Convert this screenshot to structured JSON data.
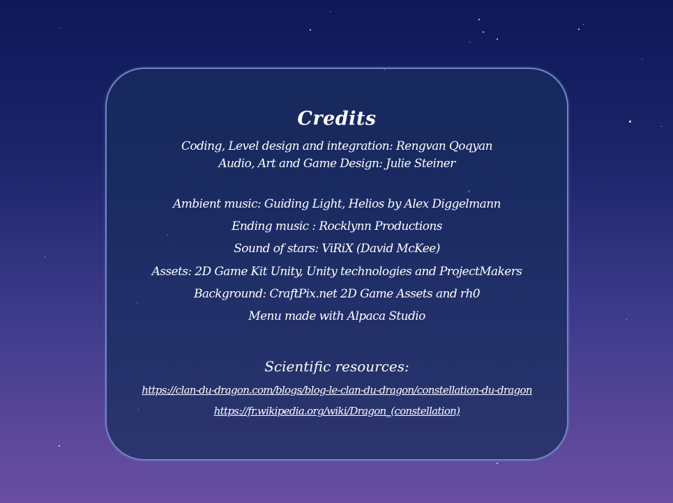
{
  "credits": {
    "title": "Credits",
    "team": [
      "Coding, Level design and integration: Rengvan Qoqyan",
      "Audio, Art and Game Design: Julie Steiner"
    ],
    "thanks": [
      "Ambient music: Guiding Light, Helios by Alex Diggelmann",
      "Ending music : Rocklynn Productions",
      "Sound of stars: ViRiX (David McKee)",
      "Assets: 2D Game Kit Unity, Unity technologies and ProjectMakers",
      "Background: CraftPix.net 2D Game Assets and rh0",
      "Menu made with Alpaca Studio"
    ],
    "scientific_heading": "Scientific resources:",
    "links": [
      "https://clan-du-dragon.com/blogs/blog-le-clan-du-dragon/constellation-du-dragon",
      "https://fr.wikipedia.org/wiki/Dragon_(constellation)"
    ]
  }
}
